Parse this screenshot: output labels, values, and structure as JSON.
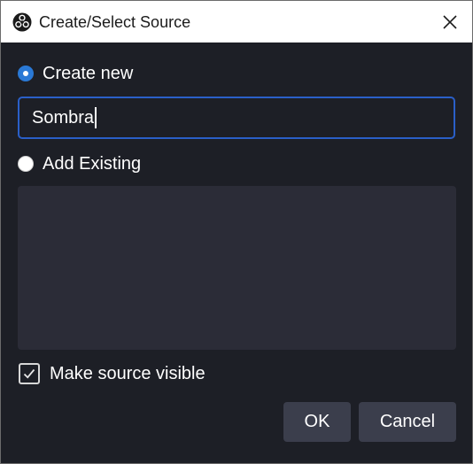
{
  "window": {
    "title": "Create/Select Source",
    "app_icon": "obs-logo-icon",
    "close_icon": "close-icon"
  },
  "create_new": {
    "label": "Create new",
    "selected": true
  },
  "name_field": {
    "value": "Sombra"
  },
  "add_existing": {
    "label": "Add Existing",
    "selected": false,
    "items": []
  },
  "make_visible": {
    "label": "Make source visible",
    "checked": true
  },
  "buttons": {
    "ok_label": "OK",
    "cancel_label": "Cancel"
  },
  "colors": {
    "background": "#1d1f26",
    "accent": "#2a79d6",
    "input_border": "#2a5fc8",
    "list_bg": "#2b2c37",
    "button_bg": "#3b3e4c"
  }
}
